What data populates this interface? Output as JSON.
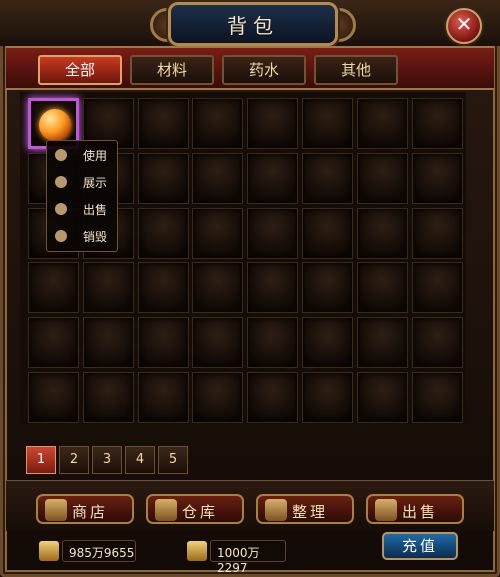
{
  "title": "背包",
  "tabs": [
    {
      "label": "全部",
      "active": true
    },
    {
      "label": "材料"
    },
    {
      "label": "药水"
    },
    {
      "label": "其他"
    }
  ],
  "context_menu": [
    {
      "label": "使用",
      "icon": "use-icon"
    },
    {
      "label": "展示",
      "icon": "show-icon"
    },
    {
      "label": "出售",
      "icon": "sell-icon"
    },
    {
      "label": "销毁",
      "icon": "destroy-icon"
    }
  ],
  "pages": [
    "1",
    "2",
    "3",
    "4",
    "5"
  ],
  "active_page": "1",
  "actions": [
    {
      "label": "商店",
      "icon": "shop-icon"
    },
    {
      "label": "仓库",
      "icon": "warehouse-icon"
    },
    {
      "label": "整理",
      "icon": "sort-icon"
    },
    {
      "label": "出售",
      "icon": "sell-bag-icon"
    }
  ],
  "currency": [
    {
      "value": "985万9655",
      "icon": "gold-ingot-icon"
    },
    {
      "value": "1000万2297",
      "icon": "bound-gold-icon"
    }
  ],
  "recharge_label": "充值",
  "inventory": {
    "columns": 8,
    "rows": 6,
    "selected_item": "orange-orb-item"
  },
  "colors": {
    "accent": "#c93a22",
    "selected_border": "#c057d9",
    "title_plate": "#1c2f48"
  }
}
